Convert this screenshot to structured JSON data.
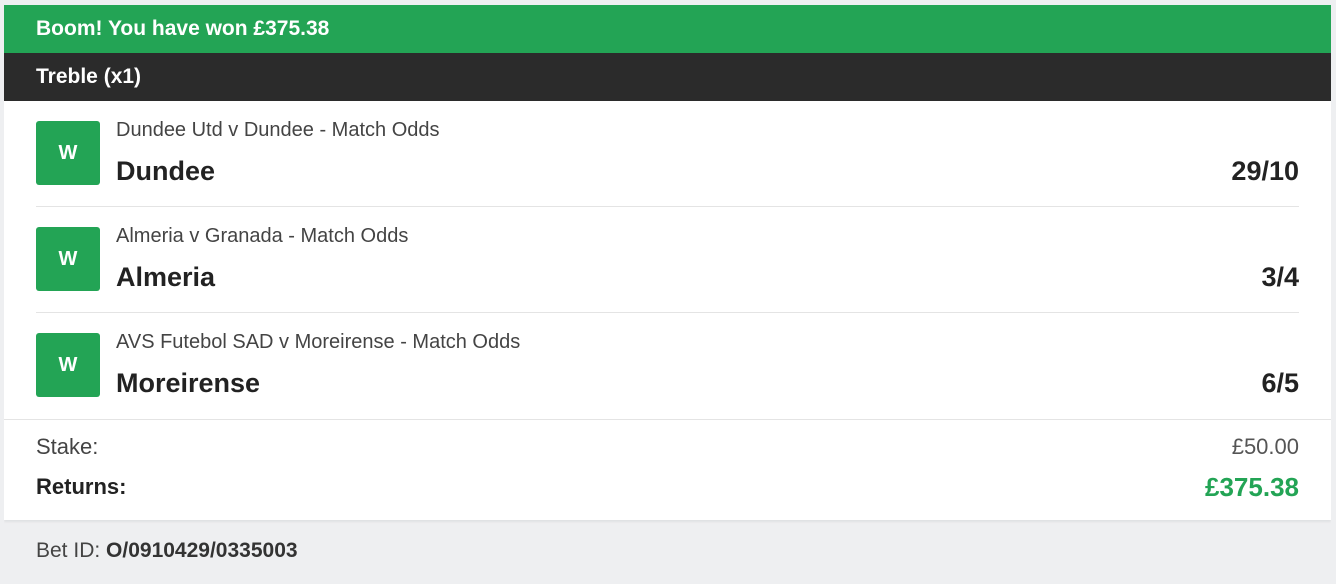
{
  "banner": {
    "text": "Boom! You have won £375.38"
  },
  "bet": {
    "type": "Treble (x1)"
  },
  "selections": [
    {
      "result": "W",
      "market": "Dundee Utd v Dundee - Match Odds",
      "runner": "Dundee",
      "odds": "29/10"
    },
    {
      "result": "W",
      "market": "Almeria v Granada - Match Odds",
      "runner": "Almeria",
      "odds": "3/4"
    },
    {
      "result": "W",
      "market": "AVS Futebol SAD v Moreirense - Match Odds",
      "runner": "Moreirense",
      "odds": "6/5"
    }
  ],
  "summary": {
    "stake_label": "Stake:",
    "stake_value": "£50.00",
    "returns_label": "Returns:",
    "returns_value": "£375.38"
  },
  "footer": {
    "bet_id_label": "Bet ID:",
    "bet_id_value": "O/0910429/0335003"
  },
  "colors": {
    "win_green": "#23a455",
    "header_dark": "#2b2b2b",
    "footer_bg": "#eeeff1"
  }
}
